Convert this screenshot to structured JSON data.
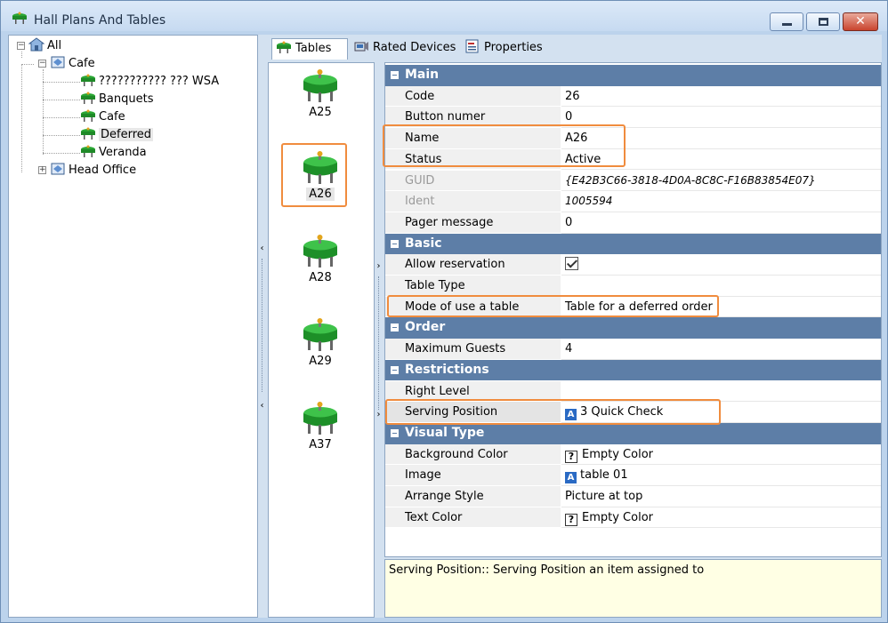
{
  "window": {
    "title": "Hall Plans And Tables",
    "title_icon": "table-icon"
  },
  "tree": {
    "root": "All",
    "cafe": "Cafe",
    "children": [
      "??????????? ??? WSA",
      "Banquets",
      "Cafe",
      "Deferred",
      "Veranda"
    ],
    "head_office": "Head Office"
  },
  "tabs": [
    {
      "label": "Tables",
      "icon": "table-icon"
    },
    {
      "label": "Rated Devices",
      "icon": "device-icon"
    },
    {
      "label": "Properties",
      "icon": "properties-icon"
    }
  ],
  "table_list": [
    {
      "label": "A25",
      "selected": false
    },
    {
      "label": "A26",
      "selected": true
    },
    {
      "label": "A28",
      "selected": false
    },
    {
      "label": "A29",
      "selected": false
    },
    {
      "label": "A37",
      "selected": false
    }
  ],
  "properties": {
    "main": {
      "title": "Main",
      "code": {
        "label": "Code",
        "value": "26"
      },
      "button_number": {
        "label": "Button numer",
        "value": "0"
      },
      "name": {
        "label": "Name",
        "value": "A26"
      },
      "status": {
        "label": "Status",
        "value": "Active"
      },
      "guid": {
        "label": "GUID",
        "value": "{E42B3C66-3818-4D0A-8C8C-F16B83854E07}"
      },
      "ident": {
        "label": "Ident",
        "value": "1005594"
      },
      "pager": {
        "label": "Pager message",
        "value": "0"
      }
    },
    "basic": {
      "title": "Basic",
      "allow_reservation": {
        "label": "Allow reservation",
        "checked": true
      },
      "table_type": {
        "label": "Table Type",
        "value": ""
      },
      "mode": {
        "label": "Mode of use a table",
        "value": "Table for a deferred order"
      }
    },
    "order": {
      "title": "Order",
      "max_guests": {
        "label": "Maximum Guests",
        "value": "4"
      }
    },
    "restrictions": {
      "title": "Restrictions",
      "right_level": {
        "label": "Right Level",
        "value": ""
      },
      "serving_position": {
        "label": "Serving Position",
        "value": "3 Quick Check",
        "badge": "A"
      }
    },
    "visual": {
      "title": "Visual Type",
      "background_color": {
        "label": "Background Color",
        "value": "Empty Color",
        "badge": "?"
      },
      "image": {
        "label": "Image",
        "value": "table 01",
        "badge": "A"
      },
      "arrange_style": {
        "label": "Arrange Style",
        "value": "Picture at top"
      },
      "text_color": {
        "label": "Text Color",
        "value": "Empty Color",
        "badge": "?"
      }
    }
  },
  "help_text": "Serving Position:: Serving Position an item assigned to",
  "colors": {
    "highlight": "#f08c3e",
    "category": "#5d7ea7",
    "table_green": "#22a22e"
  }
}
